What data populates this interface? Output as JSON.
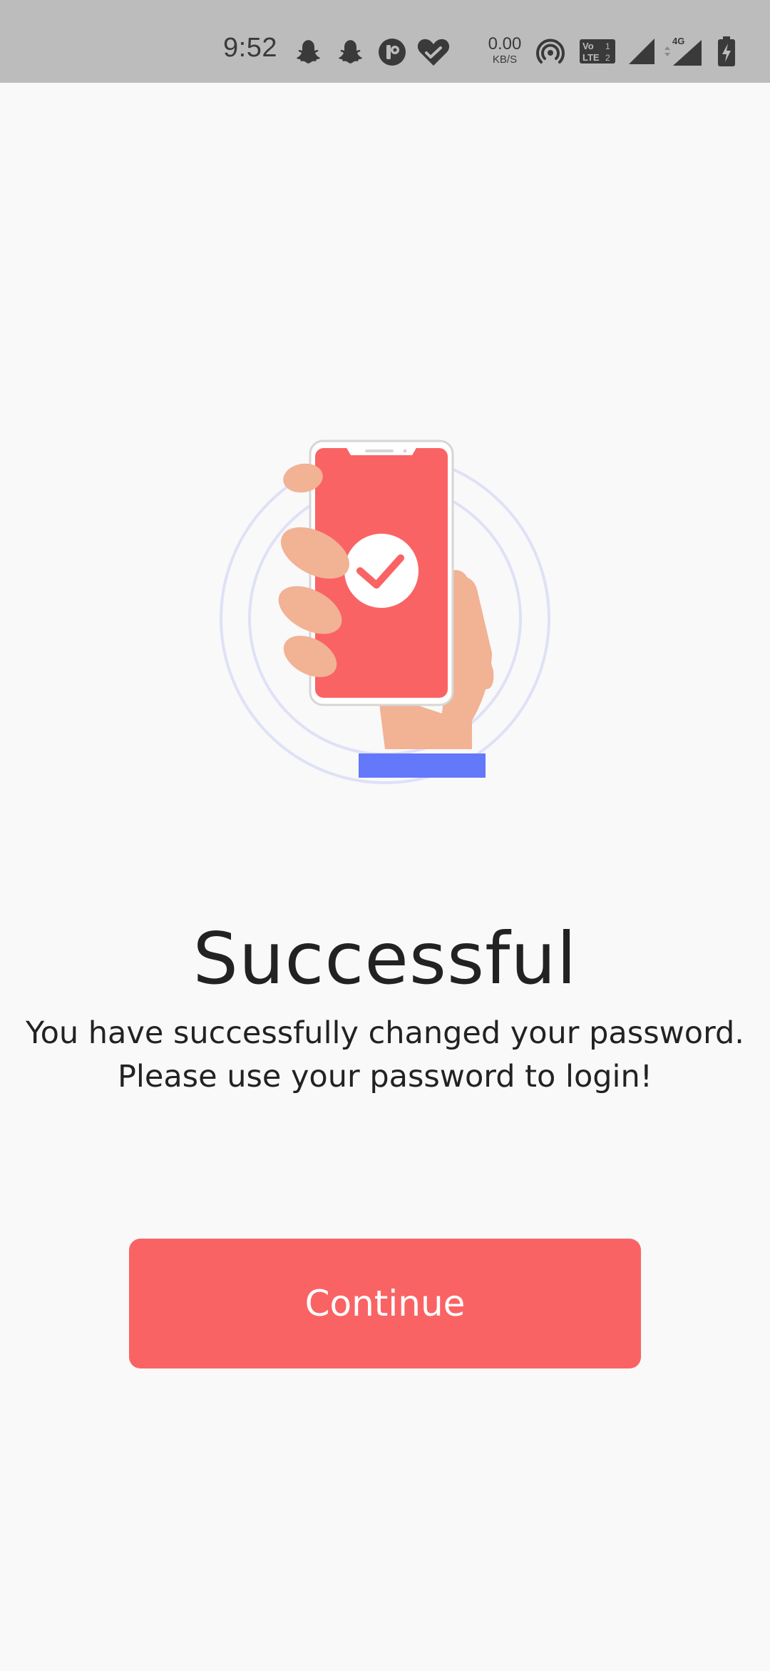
{
  "status_bar": {
    "time": "9:52",
    "net_speed_value": "0.00",
    "net_speed_unit": "KB/S",
    "network_type": "4G",
    "volte_label": "Vo LTE"
  },
  "content": {
    "title": "Successful",
    "message_line1": "You have successfully changed your password.",
    "message_line2": "Please use your password to login!",
    "continue_label": "Continue"
  },
  "colors": {
    "accent": "#fa6364",
    "background": "#f9f9f9",
    "status_bar": "#bcbcbc",
    "skin": "#f2b294",
    "sleeve": "#6478fa",
    "rings": "#dfe1f7"
  },
  "icons": [
    "snapchat-icon",
    "snapchat-icon",
    "app-icon",
    "heart-check-icon",
    "hotspot-icon",
    "volte-icon",
    "signal-icon",
    "signal-4g-icon",
    "battery-charging-icon"
  ]
}
